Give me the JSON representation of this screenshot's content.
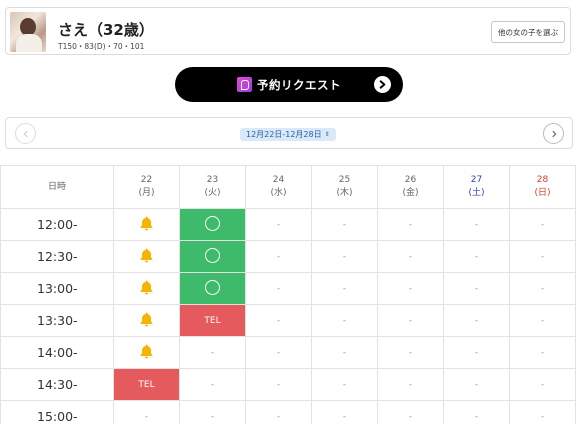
{
  "profile": {
    "name": "さえ（32歳）",
    "stats": "T150・83(D)・70・101",
    "other_button": "他の女の子を選ぶ"
  },
  "reserve": {
    "label": "予約リクエスト",
    "logo": "logo-icon",
    "arrow": "arrow-right-icon"
  },
  "date_nav": {
    "range": "12月22日-12月28日",
    "caret": "⇕",
    "prev_icon": "chevron-left-icon",
    "next_icon": "chevron-right-icon"
  },
  "schedule": {
    "header_label": "日時",
    "days": [
      {
        "date": "22",
        "dow": "(月)"
      },
      {
        "date": "23",
        "dow": "(火)"
      },
      {
        "date": "24",
        "dow": "(水)"
      },
      {
        "date": "25",
        "dow": "(木)"
      },
      {
        "date": "26",
        "dow": "(金)"
      },
      {
        "date": "27",
        "dow": "(土)"
      },
      {
        "date": "28",
        "dow": "(日)"
      }
    ],
    "rows": [
      {
        "time": "12:00-",
        "cells": [
          "bell",
          "open",
          "-",
          "-",
          "-",
          "-",
          "-"
        ]
      },
      {
        "time": "12:30-",
        "cells": [
          "bell",
          "open",
          "-",
          "-",
          "-",
          "-",
          "-"
        ]
      },
      {
        "time": "13:00-",
        "cells": [
          "bell",
          "open",
          "-",
          "-",
          "-",
          "-",
          "-"
        ]
      },
      {
        "time": "13:30-",
        "cells": [
          "bell",
          "TEL",
          "-",
          "-",
          "-",
          "-",
          "-"
        ]
      },
      {
        "time": "14:00-",
        "cells": [
          "bell",
          "-",
          "-",
          "-",
          "-",
          "-",
          "-"
        ]
      },
      {
        "time": "14:30-",
        "cells": [
          "TEL",
          "-",
          "-",
          "-",
          "-",
          "-",
          "-"
        ]
      },
      {
        "time": "15:00-",
        "cells": [
          "-",
          "-",
          "-",
          "-",
          "-",
          "-",
          "-"
        ]
      }
    ],
    "colors": {
      "open": "#3dbb6a",
      "tel": "#e55a5c",
      "bell": "#f5b400",
      "saturday": "#2b3ebf",
      "sunday": "#d8392c"
    }
  }
}
